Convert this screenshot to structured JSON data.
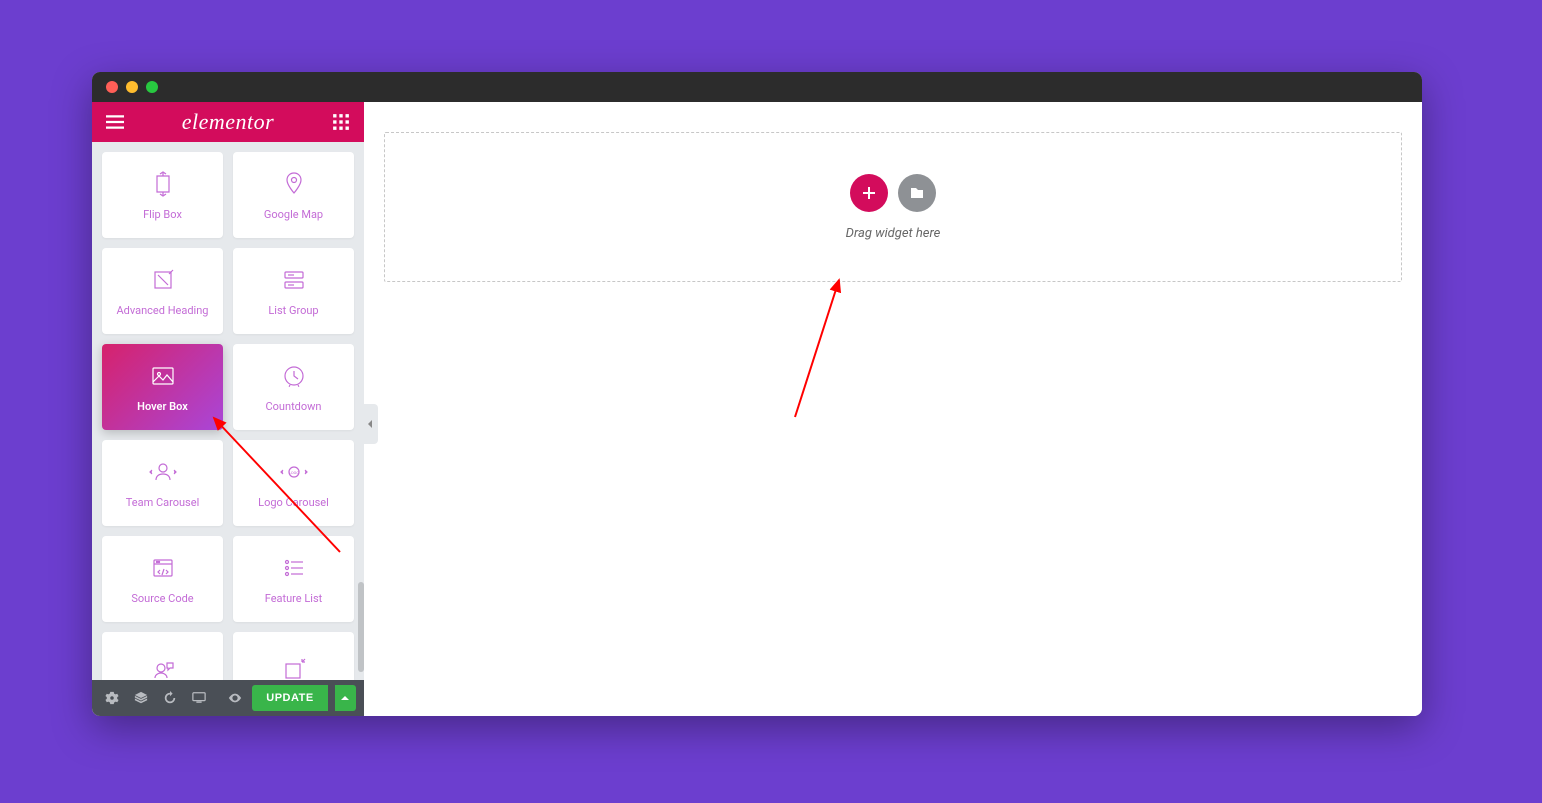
{
  "app": {
    "name": "elementor"
  },
  "widgets": [
    {
      "id": "flip-box",
      "label": "Flip Box",
      "icon": "flip-box",
      "active": false
    },
    {
      "id": "google-map",
      "label": "Google Map",
      "icon": "map-pin",
      "active": false
    },
    {
      "id": "advanced-heading",
      "label": "Advanced Heading",
      "icon": "heading",
      "active": false
    },
    {
      "id": "list-group",
      "label": "List Group",
      "icon": "list-group",
      "active": false
    },
    {
      "id": "hover-box",
      "label": "Hover Box",
      "icon": "image-box",
      "active": true
    },
    {
      "id": "countdown",
      "label": "Countdown",
      "icon": "clock",
      "active": false
    },
    {
      "id": "team-carousel",
      "label": "Team Carousel",
      "icon": "user-carousel",
      "active": false
    },
    {
      "id": "logo-carousel",
      "label": "Logo Carousel",
      "icon": "logo-carousel",
      "active": false
    },
    {
      "id": "source-code",
      "label": "Source Code",
      "icon": "code",
      "active": false
    },
    {
      "id": "feature-list",
      "label": "Feature List",
      "icon": "feature-list",
      "active": false
    },
    {
      "id": "testimonial-carousel",
      "label": "",
      "icon": "testimonial",
      "active": false
    },
    {
      "id": "animated-heading",
      "label": "",
      "icon": "heading-arrow",
      "active": false
    }
  ],
  "footer": {
    "update_label": "UPDATE"
  },
  "canvas": {
    "dropzone_text": "Drag widget here"
  }
}
